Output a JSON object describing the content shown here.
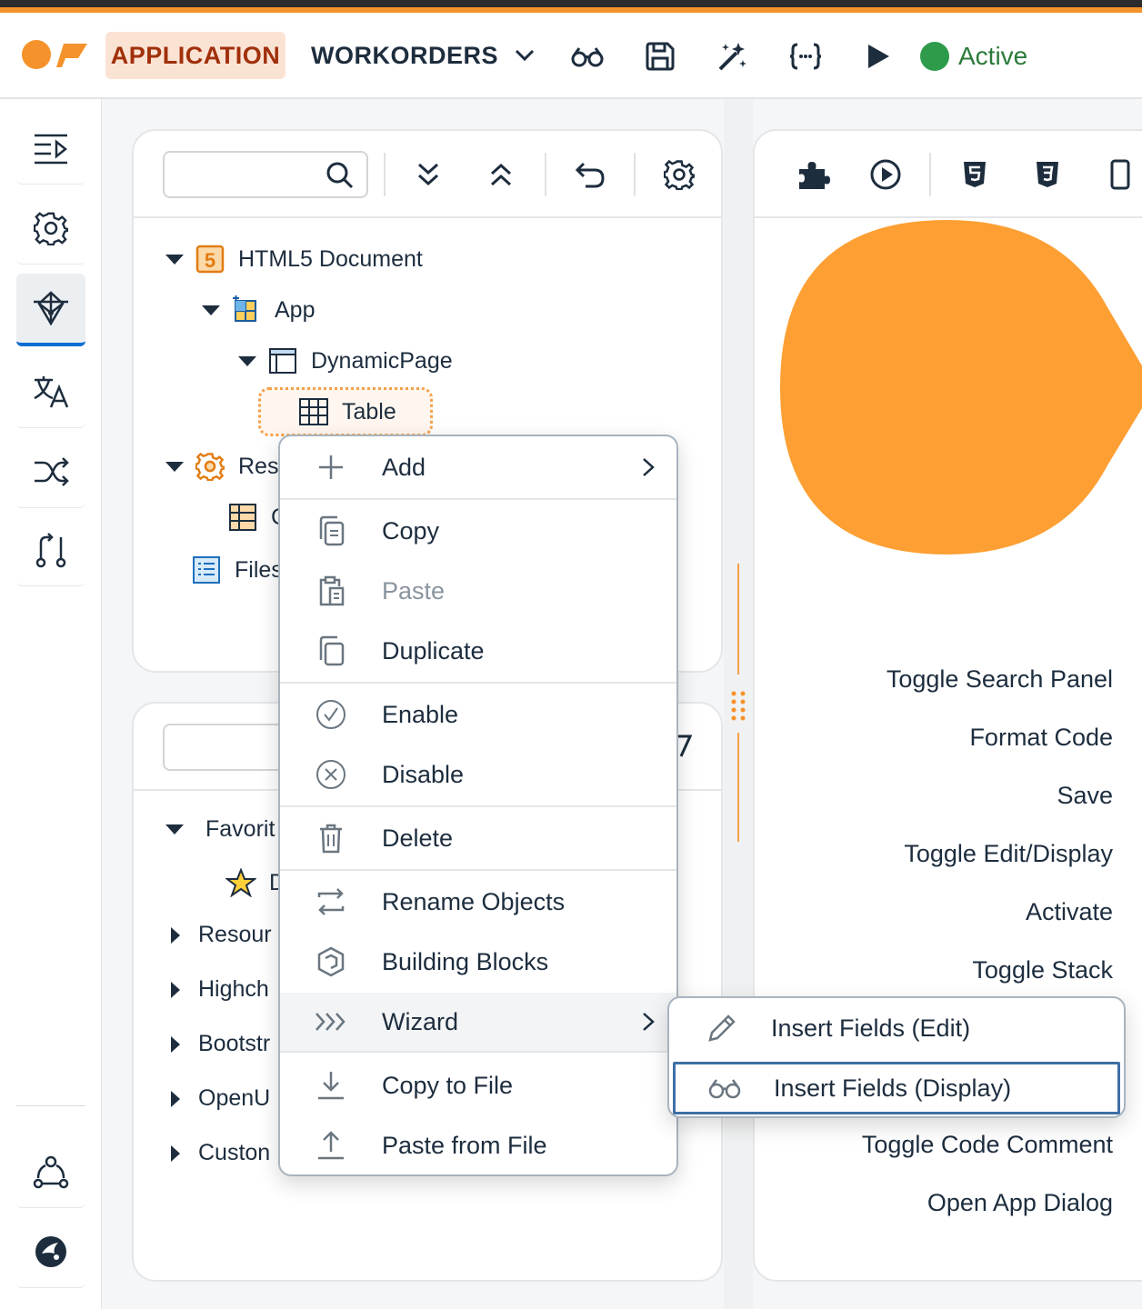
{
  "header": {
    "app_button": "APPLICATION",
    "workorders_button": "WORKORDERS",
    "icons": [
      "glasses-icon",
      "save-icon",
      "magic-wand-icon",
      "code-braces-icon",
      "play-icon"
    ],
    "status": "Active",
    "status_color": "#2d9b4a"
  },
  "sidebar": {
    "items": [
      "outline-icon",
      "settings-icon",
      "network-icon",
      "translate-icon",
      "shuffle-icon",
      "flow-icon"
    ],
    "active_index": 2,
    "bottom": [
      "hierarchy-icon",
      "bird-icon"
    ]
  },
  "tree": {
    "nodes": {
      "html5": "HTML5 Document",
      "app": "App",
      "dynamic_page": "DynamicPage",
      "table": "Table",
      "resources": "Reso",
      "resources_child": "C",
      "files": "Files"
    }
  },
  "library": {
    "groups": {
      "favorites": "Favorit",
      "favorites_child": "D",
      "resources": "Resour",
      "highcharts": "Highch",
      "bootstrap": "Bootstr",
      "openui": "OpenU",
      "custom": "Custon"
    }
  },
  "context_menu": {
    "add": "Add",
    "copy": "Copy",
    "paste": "Paste",
    "duplicate": "Duplicate",
    "enable": "Enable",
    "disable": "Disable",
    "delete": "Delete",
    "rename": "Rename Objects",
    "building_blocks": "Building Blocks",
    "wizard": "Wizard",
    "copy_to_file": "Copy to File",
    "paste_from_file": "Paste from File"
  },
  "submenu": {
    "insert_edit": "Insert Fields (Edit)",
    "insert_display": "Insert Fields (Display)"
  },
  "shortcuts": {
    "toggle_search": "Toggle Search Panel",
    "format_code": "Format Code",
    "save": "Save",
    "toggle_edit": "Toggle Edit/Display",
    "activate": "Activate",
    "toggle_stack": "Toggle Stack",
    "toggle_comment": "Toggle Code Comment",
    "open_app": "Open App Dialog"
  },
  "colors": {
    "accent": "#f5922b",
    "brand_orange": "#fd9f33",
    "focus_border": "#3f6fa6"
  }
}
